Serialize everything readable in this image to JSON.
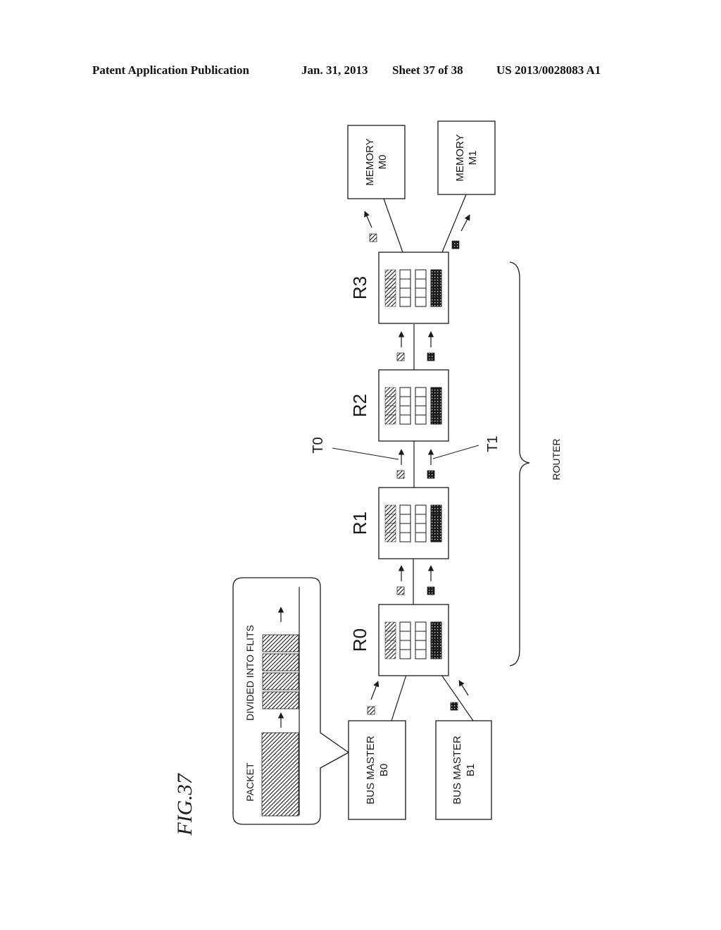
{
  "header": {
    "left": "Patent Application Publication",
    "date": "Jan. 31, 2013",
    "sheet": "Sheet 37 of 38",
    "number": "US 2013/0028083 A1"
  },
  "figure": {
    "label": "FIG.37"
  },
  "memories": [
    {
      "line1": "MEMORY",
      "line2": "M0"
    },
    {
      "line1": "MEMORY",
      "line2": "M1"
    }
  ],
  "routers": [
    {
      "name": "R0"
    },
    {
      "name": "R1"
    },
    {
      "name": "R2"
    },
    {
      "name": "R3"
    }
  ],
  "bus_masters": [
    {
      "line1": "BUS MASTER",
      "line2": "B0"
    },
    {
      "line1": "BUS MASTER",
      "line2": "B1"
    }
  ],
  "callout": {
    "packet_label": "PACKET",
    "flits_label": "DIVIDED INTO FLITS",
    "flit_count": 4
  },
  "flow_labels": {
    "t0": "T0",
    "t1": "T1"
  },
  "group_label": "ROUTER",
  "router_buffers": {
    "columns": 4,
    "slots_per_column": 4,
    "fill_pattern": [
      "hatched",
      "empty",
      "empty",
      "dotted"
    ]
  },
  "colors": {
    "ink": "#1a1a1a",
    "background": "#ffffff"
  }
}
